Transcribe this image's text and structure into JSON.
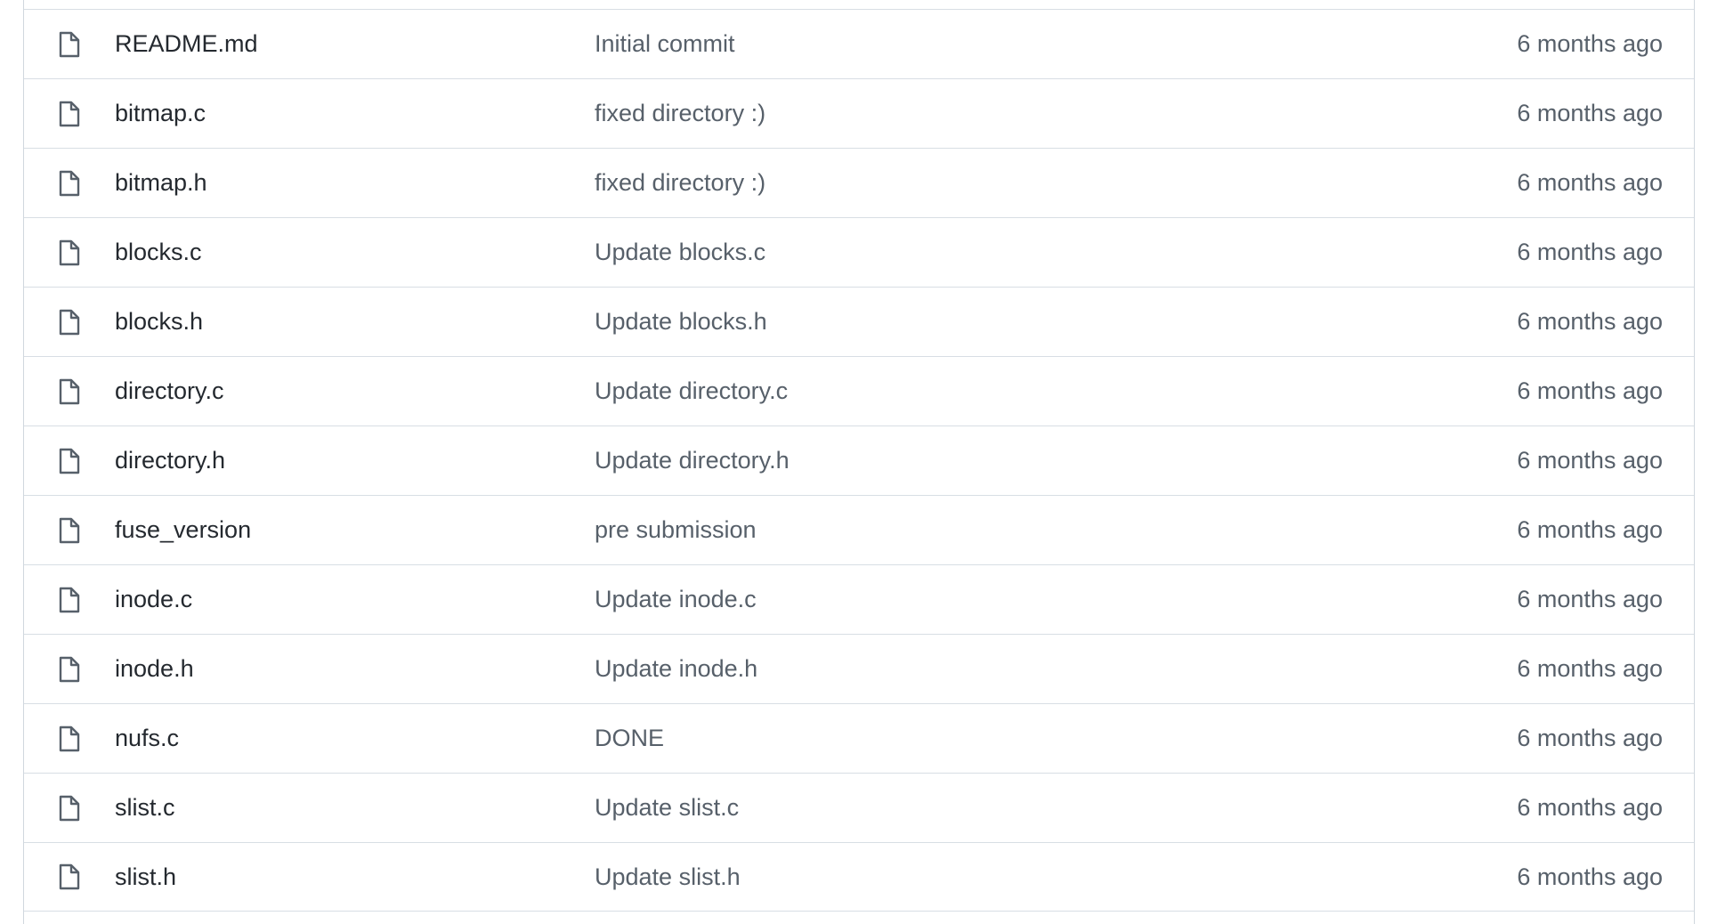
{
  "file_list": {
    "rows": [
      {
        "name": "README.md",
        "message": "Initial commit",
        "age": "6 months ago",
        "icon": "file-icon"
      },
      {
        "name": "bitmap.c",
        "message": "fixed directory :)",
        "age": "6 months ago",
        "icon": "file-icon"
      },
      {
        "name": "bitmap.h",
        "message": "fixed directory :)",
        "age": "6 months ago",
        "icon": "file-icon"
      },
      {
        "name": "blocks.c",
        "message": "Update blocks.c",
        "age": "6 months ago",
        "icon": "file-icon"
      },
      {
        "name": "blocks.h",
        "message": "Update blocks.h",
        "age": "6 months ago",
        "icon": "file-icon"
      },
      {
        "name": "directory.c",
        "message": "Update directory.c",
        "age": "6 months ago",
        "icon": "file-icon"
      },
      {
        "name": "directory.h",
        "message": "Update directory.h",
        "age": "6 months ago",
        "icon": "file-icon"
      },
      {
        "name": "fuse_version",
        "message": "pre submission",
        "age": "6 months ago",
        "icon": "file-icon"
      },
      {
        "name": "inode.c",
        "message": "Update inode.c",
        "age": "6 months ago",
        "icon": "file-icon"
      },
      {
        "name": "inode.h",
        "message": "Update inode.h",
        "age": "6 months ago",
        "icon": "file-icon"
      },
      {
        "name": "nufs.c",
        "message": "DONE",
        "age": "6 months ago",
        "icon": "file-icon"
      },
      {
        "name": "slist.c",
        "message": "Update slist.c",
        "age": "6 months ago",
        "icon": "file-icon"
      },
      {
        "name": "slist.h",
        "message": "Update slist.h",
        "age": "6 months ago",
        "icon": "file-icon"
      }
    ]
  },
  "colors": {
    "border": "#d0d7de",
    "row_divider": "#d8dee4",
    "file_name": "#24292f",
    "muted_text": "#57606a",
    "icon": "#57606a"
  }
}
